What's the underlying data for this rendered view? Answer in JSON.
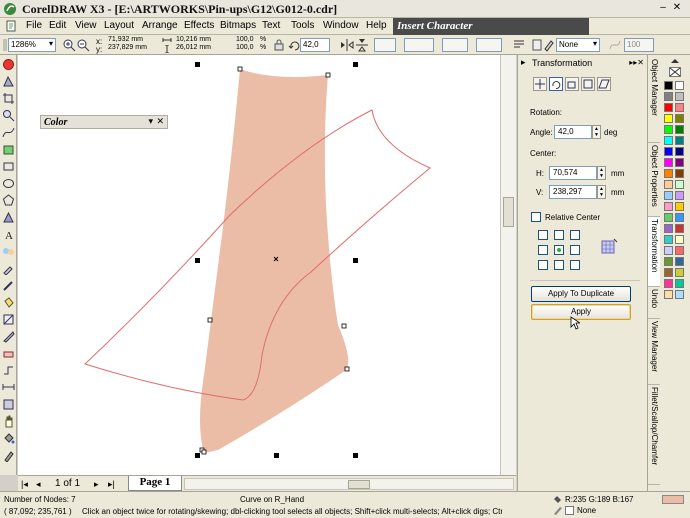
{
  "window": {
    "title": "CorelDRAW X3 - [E:\\ARTWORKS\\Pin-ups\\G12\\G012-0.cdr]"
  },
  "menu": {
    "items": [
      "File",
      "Edit",
      "View",
      "Layout",
      "Arrange",
      "Effects",
      "Bitmaps",
      "Text",
      "Tools",
      "Window",
      "Help"
    ]
  },
  "insert_character": {
    "title": "Insert Character"
  },
  "property_bar": {
    "zoom": "1286%",
    "x": "71,932 mm",
    "y": "237,829 mm",
    "width": "10,216 mm",
    "height": "26,012 mm",
    "scale_x": "100,0",
    "scale_y": "100,0",
    "scale_unit": "%",
    "angle": "42,0",
    "outline": "None",
    "outline_scale": "100"
  },
  "color_docker": {
    "title": "Color"
  },
  "page_nav": {
    "page_count": "1 of 1",
    "page_tab": "Page 1"
  },
  "transformation": {
    "title": "Transformation",
    "rotation_label": "Rotation:",
    "angle_label": "Angle:",
    "angle_value": "42,0",
    "angle_unit": "deg",
    "center_label": "Center:",
    "h_label": "H:",
    "h_value": "70,574",
    "v_label": "V:",
    "v_value": "238,297",
    "unit": "mm",
    "relative_center": "Relative Center",
    "apply_duplicate": "Apply To Duplicate",
    "apply": "Apply"
  },
  "vertical_tabs": [
    "Object Manager",
    "Object Properties",
    "Transformation",
    "Undo",
    "View Manager",
    "Fillet/Scallop/Chamfer"
  ],
  "status": {
    "nodes": "Number of Nodes: 7",
    "curve": "Curve on R_Hand",
    "coords": "( 87,092; 235,761 )",
    "hint": "Click an object twice for rotating/skewing; dbl-clicking tool selects all objects; Shift+click multi-selects; Alt+click digs; Ctrl+...",
    "fill_color": "R:235 G:189 B:167",
    "outline_none": "None"
  },
  "colors": {
    "shape_fill": "#ebbda7",
    "outline_red": "#e06c6c"
  },
  "palette": [
    "#000000",
    "#ffffff",
    "#808080",
    "#c0c0c0",
    "#ff0000",
    "#ff8080",
    "#ffff00",
    "#808000",
    "#00ff00",
    "#008000",
    "#00ffff",
    "#008080",
    "#0000ff",
    "#000080",
    "#ff00ff",
    "#800080",
    "#ff8000",
    "#804000",
    "#ffcc99",
    "#ccffcc",
    "#99ccff",
    "#cc99ff",
    "#ff99cc",
    "#ffcc00",
    "#66cc66",
    "#3399ff",
    "#9966cc",
    "#cc3333",
    "#33cccc",
    "#ffffcc",
    "#ccccff",
    "#ff6666",
    "#669933",
    "#336699",
    "#996633",
    "#cccc33",
    "#ff3399",
    "#00cc99",
    "#ffddaa",
    "#aaddff"
  ]
}
